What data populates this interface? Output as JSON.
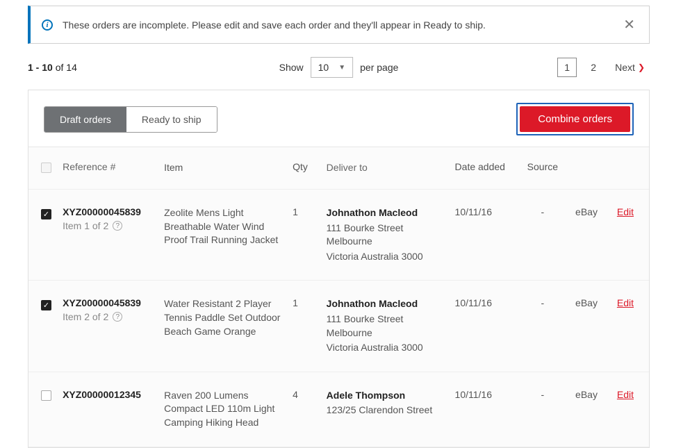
{
  "alert": {
    "message": "These orders are incomplete. Please edit and save each order and they'll appear in Ready to ship."
  },
  "paging": {
    "range": "1 - 10",
    "of_label": "of",
    "total": "14",
    "show_label": "Show",
    "per_page_value": "10",
    "per_page_suffix": "per page",
    "pages": [
      "1",
      "2"
    ],
    "next_label": "Next"
  },
  "tabs": {
    "draft": "Draft orders",
    "ready": "Ready to ship"
  },
  "combine_label": "Combine orders",
  "headers": {
    "ref": "Reference #",
    "item": "Item",
    "qty": "Qty",
    "deliver": "Deliver to",
    "date": "Date added",
    "source": "Source"
  },
  "edit_label": "Edit",
  "rows": [
    {
      "checked": true,
      "ref": "XYZ00000045839",
      "item_of": "Item 1 of 2",
      "item": "Zeolite Mens Light Breathable Water Wind Proof Trail Running Jacket",
      "qty": "1",
      "name": "Johnathon Macleod",
      "addr1": "111 Bourke Street Melbourne",
      "addr2": "Victoria Australia 3000",
      "date": "10/11/16",
      "source": "-",
      "platform": "eBay"
    },
    {
      "checked": true,
      "ref": "XYZ00000045839",
      "item_of": "Item 2 of 2",
      "item": "Water Resistant 2 Player Tennis Paddle Set Outdoor Beach Game Orange",
      "qty": "1",
      "name": "Johnathon Macleod",
      "addr1": "111 Bourke Street Melbourne",
      "addr2": "Victoria Australia 3000",
      "date": "10/11/16",
      "source": "-",
      "platform": "eBay"
    },
    {
      "checked": false,
      "ref": "XYZ00000012345",
      "item_of": "",
      "item": "Raven 200 Lumens Compact LED 110m Light Camping Hiking Head",
      "qty": "4",
      "name": "Adele Thompson",
      "addr1": "123/25 Clarendon Street",
      "addr2": "",
      "date": "10/11/16",
      "source": "-",
      "platform": "eBay"
    }
  ]
}
